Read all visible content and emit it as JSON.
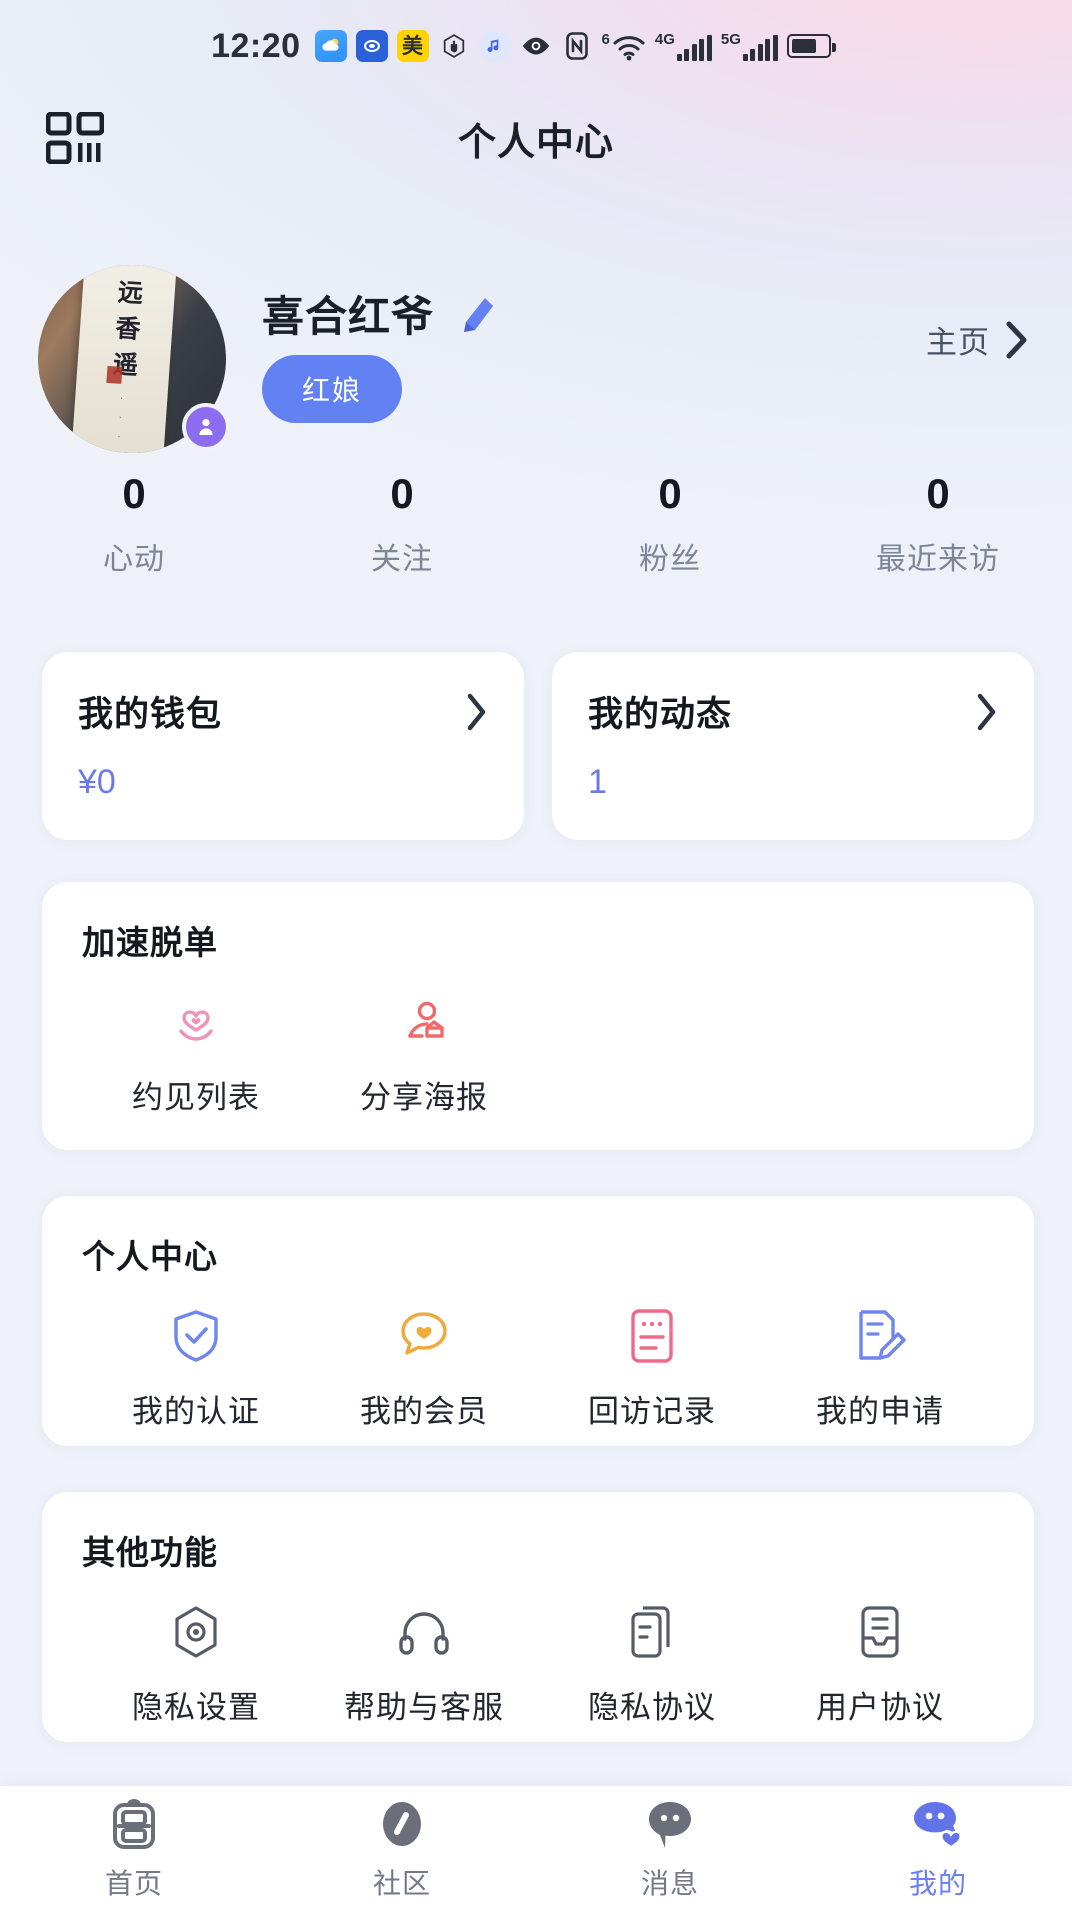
{
  "statusbar": {
    "time": "12:20",
    "icons": [
      "weather-icon",
      "alipay-icon",
      "meituan-icon",
      "hand-icon",
      "music-icon",
      "eye-icon",
      "nfc-icon",
      "wifi-6-icon",
      "signal-4g-icon",
      "signal-5g-icon",
      "battery-icon"
    ],
    "wifi_gen": "6",
    "net1": "4G",
    "net2": "5G"
  },
  "navbar": {
    "title": "个人中心",
    "qr_icon": "qr-code-icon"
  },
  "profile": {
    "nickname": "喜合红爷",
    "edit_icon": "pencil-edit-icon",
    "role_badge": "红娘",
    "homepage_label": "主页",
    "homepage_chevron": "chevron-right-icon",
    "avatar_badge_icon": "user-badge-icon",
    "avatar_alt": "远香遥"
  },
  "stats": [
    {
      "value": "0",
      "label": "心动"
    },
    {
      "value": "0",
      "label": "关注"
    },
    {
      "value": "0",
      "label": "粉丝"
    },
    {
      "value": "0",
      "label": "最近来访"
    }
  ],
  "wallet": {
    "title": "我的钱包",
    "value": "¥0",
    "chevron": "chevron-right-icon"
  },
  "moments": {
    "title": "我的动态",
    "value": "1",
    "chevron": "chevron-right-icon"
  },
  "boost": {
    "title": "加速脱单",
    "items": [
      {
        "label": "约见列表",
        "icon": "heart-hands-icon"
      },
      {
        "label": "分享海报",
        "icon": "share-person-icon"
      }
    ]
  },
  "center": {
    "title": "个人中心",
    "items": [
      {
        "label": "我的认证",
        "icon": "shield-check-icon"
      },
      {
        "label": "我的会员",
        "icon": "heart-chat-icon"
      },
      {
        "label": "回访记录",
        "icon": "record-list-icon"
      },
      {
        "label": "我的申请",
        "icon": "document-edit-icon"
      }
    ]
  },
  "other": {
    "title": "其他功能",
    "items": [
      {
        "label": "隐私设置",
        "icon": "privacy-hexagon-icon"
      },
      {
        "label": "帮助与客服",
        "icon": "headset-icon"
      },
      {
        "label": "隐私协议",
        "icon": "documents-icon"
      },
      {
        "label": "用户协议",
        "icon": "agreement-inbox-icon"
      }
    ]
  },
  "tabbar": {
    "items": [
      {
        "label": "首页",
        "icon": "double-happiness-icon",
        "active": false
      },
      {
        "label": "社区",
        "icon": "community-icon",
        "active": false
      },
      {
        "label": "消息",
        "icon": "message-bubble-icon",
        "active": false
      },
      {
        "label": "我的",
        "icon": "profile-heart-icon",
        "active": true
      }
    ]
  },
  "colors": {
    "accent": "#6281f2",
    "link": "#6b7ae8",
    "text": "#14181f",
    "muted": "#7e8596",
    "pink": "#ef93b8",
    "red": "#ef6a6a",
    "orange": "#f2a93b",
    "blue": "#6f86ef"
  }
}
